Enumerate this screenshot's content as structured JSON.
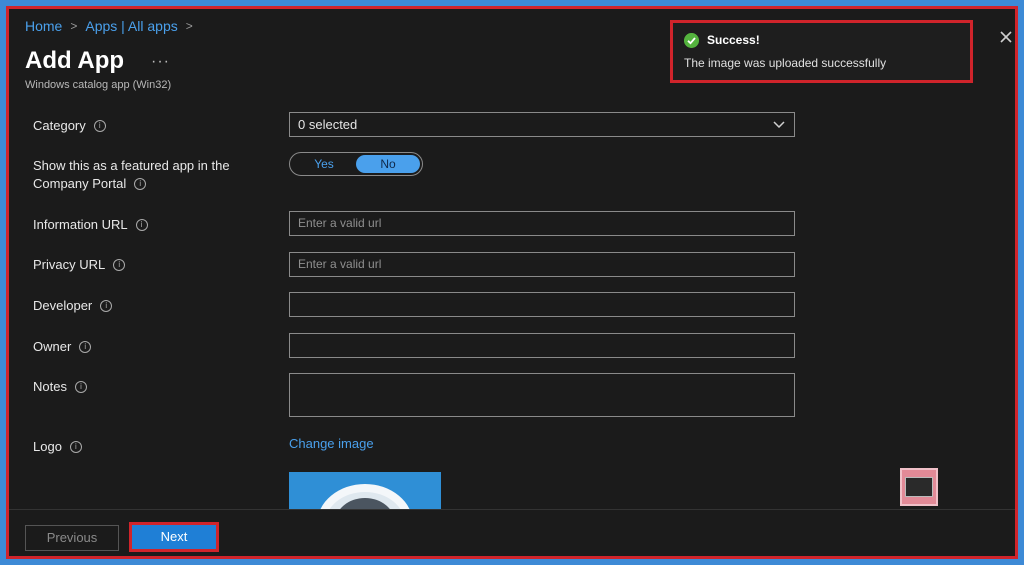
{
  "breadcrumb": {
    "home": "Home",
    "apps": "Apps | All apps"
  },
  "header": {
    "title": "Add App",
    "more": "···",
    "subtitle": "Windows catalog app (Win32)"
  },
  "form": {
    "category": {
      "label": "Category",
      "value": "0 selected"
    },
    "featured": {
      "label_line1": "Show this as a featured app in the",
      "label_line2": "Company Portal",
      "yes": "Yes",
      "no": "No",
      "selected": "No"
    },
    "information_url": {
      "label": "Information URL",
      "placeholder": "Enter a valid url"
    },
    "privacy_url": {
      "label": "Privacy URL",
      "placeholder": "Enter a valid url"
    },
    "developer": {
      "label": "Developer",
      "value": ""
    },
    "owner": {
      "label": "Owner",
      "value": ""
    },
    "notes": {
      "label": "Notes",
      "value": ""
    },
    "logo": {
      "label": "Logo",
      "change_link": "Change image"
    }
  },
  "footer": {
    "previous": "Previous",
    "next": "Next"
  },
  "toast": {
    "title": "Success!",
    "message": "The image was uploaded successfully"
  },
  "icons": {
    "info": "info-icon",
    "success": "check-circle-icon",
    "close": "close-icon",
    "dropdown": "chevron-down-icon"
  },
  "colors": {
    "accent": "#4aa0ec",
    "background": "#1b1b1b",
    "success": "#54b33e",
    "highlight_border": "#d0242b"
  }
}
